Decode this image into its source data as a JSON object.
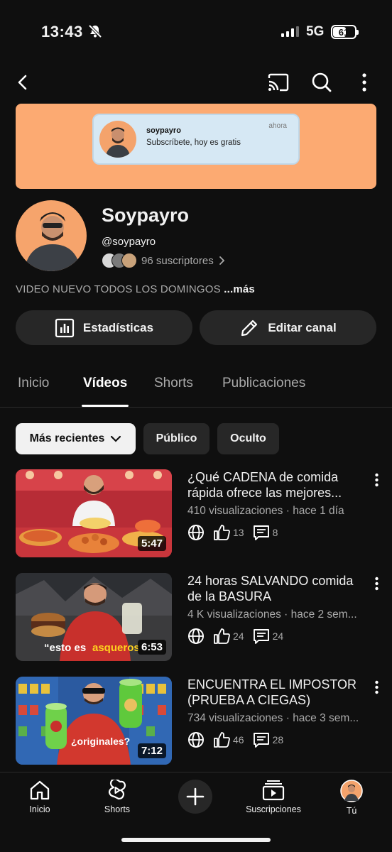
{
  "status_bar": {
    "time": "13:43",
    "network": "5G",
    "battery": "61",
    "battery_level": 0.61
  },
  "app_bar": {
    "icons": [
      "back-arrow-icon",
      "cast-icon",
      "search-icon",
      "more-vertical-icon"
    ]
  },
  "banner": {
    "notification_name": "soypayro",
    "notification_text": "Subscríbete, hoy es gratis",
    "notification_time": "ahora"
  },
  "channel": {
    "name": "Soypayro",
    "handle": "@soypayro",
    "subscribers": "96 suscriptores",
    "description": "VIDEO NUEVO TODOS LOS DOMINGOS",
    "more_label": "...más"
  },
  "actions": {
    "stats_label": "Estadísticas",
    "edit_label": "Editar canal"
  },
  "tabs": [
    {
      "label": "Inicio",
      "active": false
    },
    {
      "label": "Vídeos",
      "active": true
    },
    {
      "label": "Shorts",
      "active": false
    },
    {
      "label": "Publicaciones",
      "active": false
    }
  ],
  "filters": {
    "sort_label": "Más recientes",
    "public_label": "Público",
    "hidden_label": "Oculto"
  },
  "videos": [
    {
      "title": "¿Qué CADENA de comida rápida ofrece las mejores...",
      "meta": "410 visualizaciones · hace 1 día",
      "duration": "5:47",
      "likes": "13",
      "comments": "8",
      "thumb_colors": [
        "#c8323a",
        "#e8704a"
      ]
    },
    {
      "title": "24 horas SALVANDO comida de la BASURA",
      "meta": "4 K visualizaciones · hace 2 sem...",
      "duration": "6:53",
      "likes": "24",
      "comments": "24",
      "thumb_text": "“esto es asqueros",
      "thumb_colors": [
        "#3a3a3c",
        "#b8322f"
      ]
    },
    {
      "title": "ENCUENTRA EL IMPOSTOR (PRUEBA A CIEGAS)",
      "meta": "734 visualizaciones · hace 3 sem...",
      "duration": "7:12",
      "likes": "46",
      "comments": "28",
      "thumb_text": "¿originales?",
      "thumb_colors": [
        "#2d5fa8",
        "#d4422c"
      ]
    }
  ],
  "bottom_nav": [
    {
      "label": "Inicio",
      "icon": "home-icon"
    },
    {
      "label": "Shorts",
      "icon": "shorts-icon"
    },
    {
      "label": "",
      "icon": "create-plus-icon"
    },
    {
      "label": "Suscripciones",
      "icon": "subscriptions-icon"
    },
    {
      "label": "Tú",
      "icon": "profile-avatar"
    }
  ],
  "colors": {
    "background": "#0f0f0f",
    "surface": "#272727",
    "banner": "#fcaa72",
    "text_secondary": "#aaaaaa"
  }
}
